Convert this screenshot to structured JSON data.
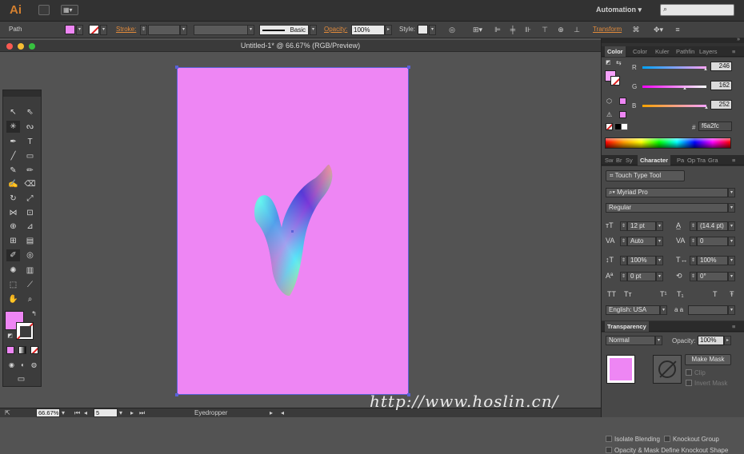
{
  "app": {
    "logo": "Ai",
    "workspace": "Automation",
    "search_icon": "search-icon",
    "search_placeholder": ""
  },
  "control_bar": {
    "selection_label": "Path",
    "fill_color": "#ee86f4",
    "stroke_link": "Stroke:",
    "brush_label": "Basic",
    "opacity_link": "Opacity:",
    "opacity_value": "100%",
    "style_label": "Style:",
    "transform_link": "Transform"
  },
  "document": {
    "title": "Untitled-1* @ 66.67% (RGB/Preview)",
    "artboard_color": "#ee86f4"
  },
  "toolbar": {
    "fill_color": "#ee86f4"
  },
  "status_bar": {
    "zoom": "66.67%",
    "artboard_number": "5",
    "current_tool": "Eyedropper"
  },
  "color_panel": {
    "tabs": [
      "Color",
      "Color",
      "Kuler",
      "Pathfin",
      "Layers"
    ],
    "r_label": "R",
    "g_label": "G",
    "b_label": "B",
    "r": "246",
    "g": "162",
    "b": "252",
    "hex_prefix": "#",
    "hex": "f6a2fc"
  },
  "character_panel": {
    "tabs": [
      "Sw",
      "Br",
      "Sy",
      "Character",
      "Pa",
      "Op",
      "Tra",
      "Gra"
    ],
    "touch_type": "Touch Type Tool",
    "font_family": "Myriad Pro",
    "font_style": "Regular",
    "font_size": "12 pt",
    "leading": "(14.4 pt)",
    "kerning": "Auto",
    "tracking": "0",
    "vertical_scale": "100%",
    "horizontal_scale": "100%",
    "baseline_shift": "0 pt",
    "rotation": "0°",
    "type_buttons": [
      "TT",
      "Tт",
      "T¹",
      "T₁",
      "T",
      "Ŧ"
    ],
    "language": "English: USA",
    "aa_label": "a a"
  },
  "transparency_panel": {
    "title": "Transparency",
    "blend_mode": "Normal",
    "opacity_label": "Opacity:",
    "opacity_value": "100%",
    "make_mask": "Make Mask",
    "clip": "Clip",
    "invert_mask": "Invert Mask",
    "isolate_blending": "Isolate Blending",
    "knockout_group": "Knockout Group",
    "opacity_mask_label": "Opacity & Mask Define Knockout Shape"
  },
  "watermark": "http://www.hoslin.cn/"
}
